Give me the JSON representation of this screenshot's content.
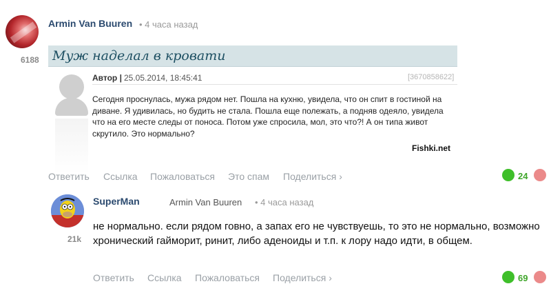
{
  "comment": {
    "author": "Armin Van Buuren",
    "time": "• 4 часа назад",
    "score": "6188",
    "embed": {
      "title": "Муж наделал в кровати",
      "author_label": "Автор |",
      "date": "25.05.2014, 18:45:41",
      "id": "[3670858622]",
      "text": "Сегодня проснулась, мужа рядом нет. Пошла на кухню, увидела, что он спит в гостиной на диване. Я удивилась, но будить не стала. Пошла еще полежать, а подняв одеяло, увидела что на его месте следы от поноса. Потом уже спросила, мол, это что?! А он типа живот скрутило. Это нормально?",
      "watermark": "Fishki.net"
    },
    "actions": {
      "reply": "Ответить",
      "link": "Ссылка",
      "complain": "Пожаловаться",
      "spam": "Это спам",
      "share": "Поделиться ›"
    },
    "rating": "24"
  },
  "reply": {
    "author": "SuperMan",
    "reply_to": "Armin Van Buuren",
    "time": "• 4 часа назад",
    "score": "21k",
    "text": "не нормально. если рядом говно, а запах его не чувствуешь, то это не нормально, возможно хронический гайморит, ринит, либо аденоиды и т.п. к лору надо идти, в общем.",
    "actions": {
      "reply": "Ответить",
      "link": "Ссылка",
      "complain": "Пожаловаться",
      "share": "Поделиться ›"
    },
    "rating": "69"
  },
  "colors": {
    "upvote": "#3fbf2a",
    "downvote": "#eb8a8a",
    "author_link": "#2b4a6f"
  }
}
